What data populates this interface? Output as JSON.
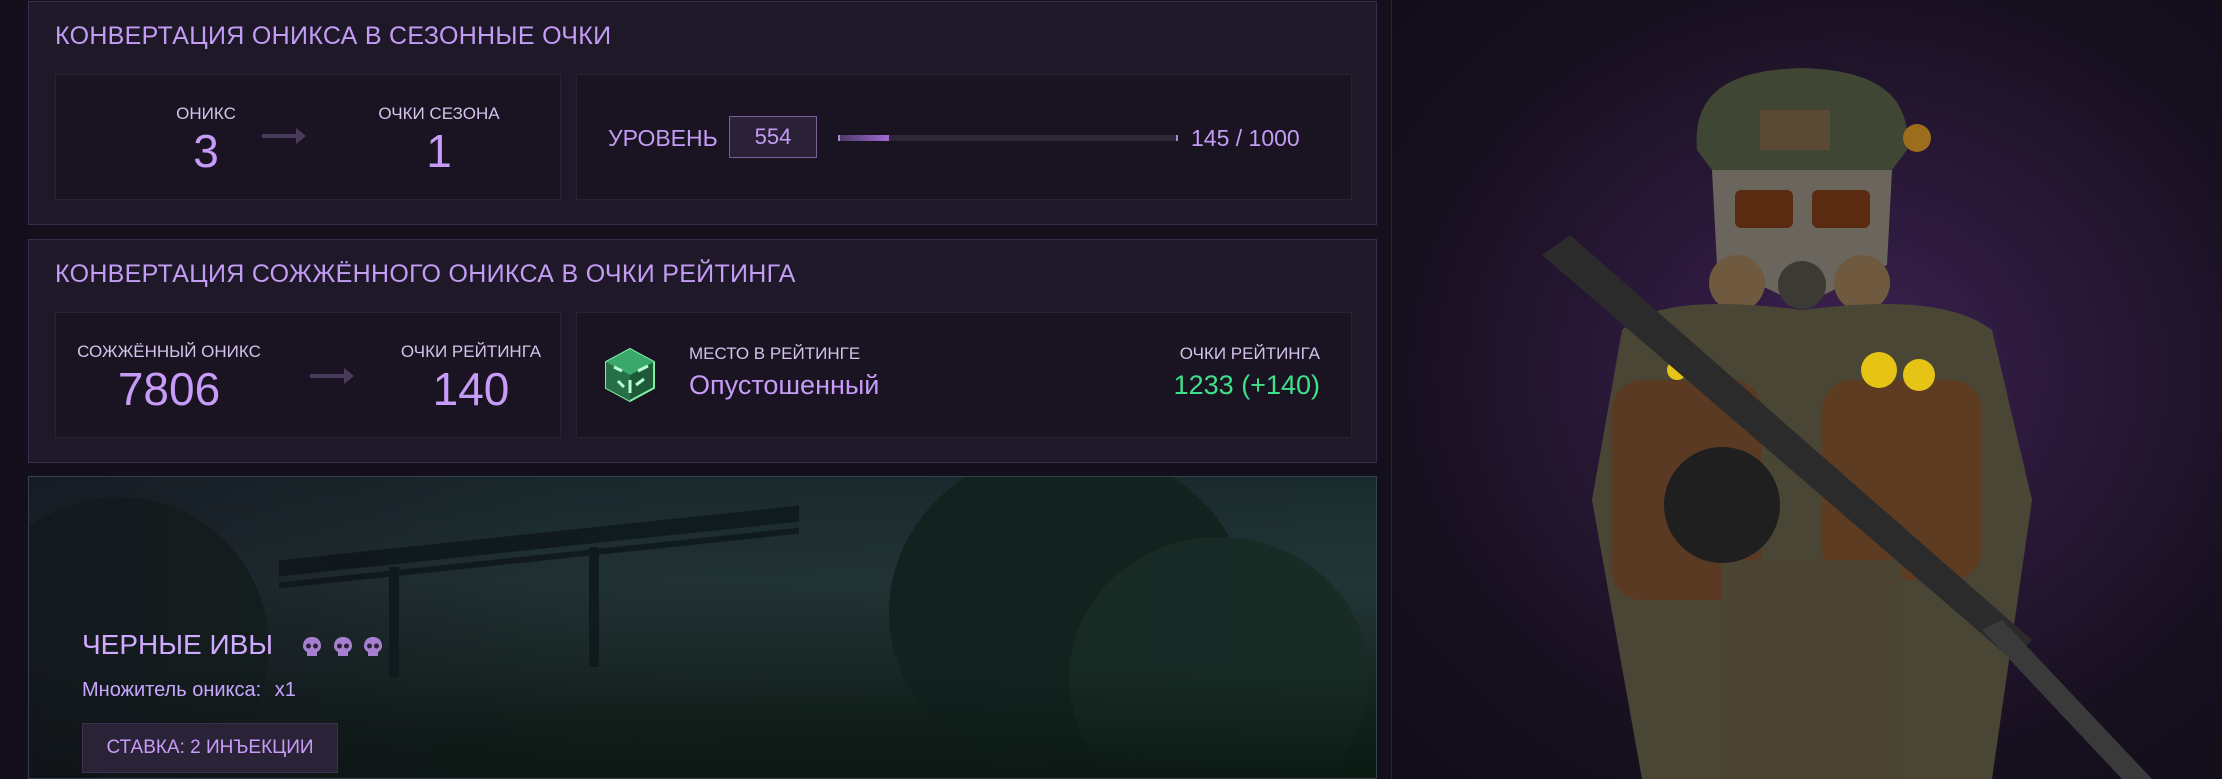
{
  "season_panel": {
    "title": "КОНВЕРТАЦИЯ ОНИКСА В СЕЗОННЫЕ ОЧКИ",
    "onyx_label": "ОНИКС",
    "onyx_value": "3",
    "season_points_label": "ОЧКИ СЕЗОНА",
    "season_points_value": "1",
    "level_label": "УРОВЕНЬ",
    "level_value": "554",
    "progress_text": "145 / 1000",
    "progress_fraction": 0.145
  },
  "rating_panel": {
    "title": "КОНВЕРТАЦИЯ СОЖЖЁННОГО ОНИКСА В ОЧКИ РЕЙТИНГА",
    "burned_onyx_label": "СОЖЖЁННЫЙ ОНИКС",
    "burned_onyx_value": "7806",
    "rating_points_label": "ОЧКИ РЕЙТИНГА",
    "rating_points_value": "140",
    "rank_label": "МЕСТО В РЕЙТИНГЕ",
    "rank_value": "Опустошенный",
    "total_rating_label": "ОЧКИ РЕЙТИНГА",
    "total_rating_value": "1233 (+140)",
    "rank_icon": "green-crystal-cube-icon"
  },
  "location": {
    "name": "ЧЕРНЫЕ ИВЫ",
    "difficulty_icons": [
      "skull-icon",
      "skull-icon",
      "skull-icon"
    ],
    "multiplier_label": "Множитель оникса:",
    "multiplier_value": "x1",
    "bet_button": "СТАВКА: 2 ИНЪЕКЦИИ"
  },
  "colors": {
    "accent": "#c79cf8",
    "rating_green": "#3fe08a",
    "panel_bg": "#1f1829",
    "page_bg": "#140f1c"
  }
}
